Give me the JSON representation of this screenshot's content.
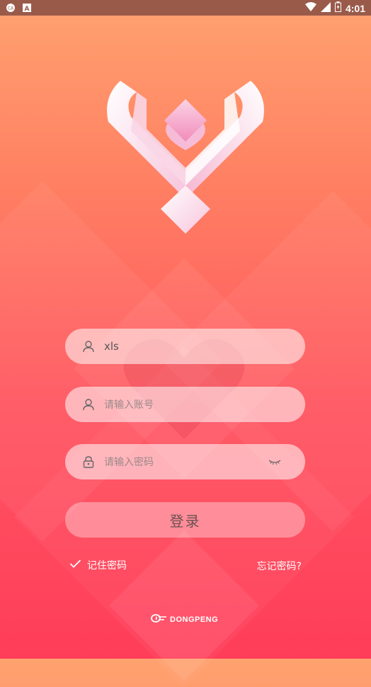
{
  "status_bar": {
    "time": "4:01"
  },
  "login": {
    "username_value": "xls",
    "account_placeholder": "请输入账号",
    "password_placeholder": "请输入密码",
    "login_label": "登录",
    "remember_label": "记住密码",
    "forgot_label": "忘记密码?"
  },
  "footer": {
    "brand": "DONGPENG"
  },
  "colors": {
    "gradient_top": "#ffa26f",
    "gradient_bottom": "#ff3d5a",
    "input_bg": "rgba(255,255,255,0.55)"
  },
  "icons": [
    "carrier-icon",
    "a-icon",
    "wifi-icon",
    "signal-icon",
    "battery-icon",
    "user-icon",
    "lock-icon",
    "eye-closed-icon",
    "check-icon",
    "brand-logo-icon"
  ]
}
